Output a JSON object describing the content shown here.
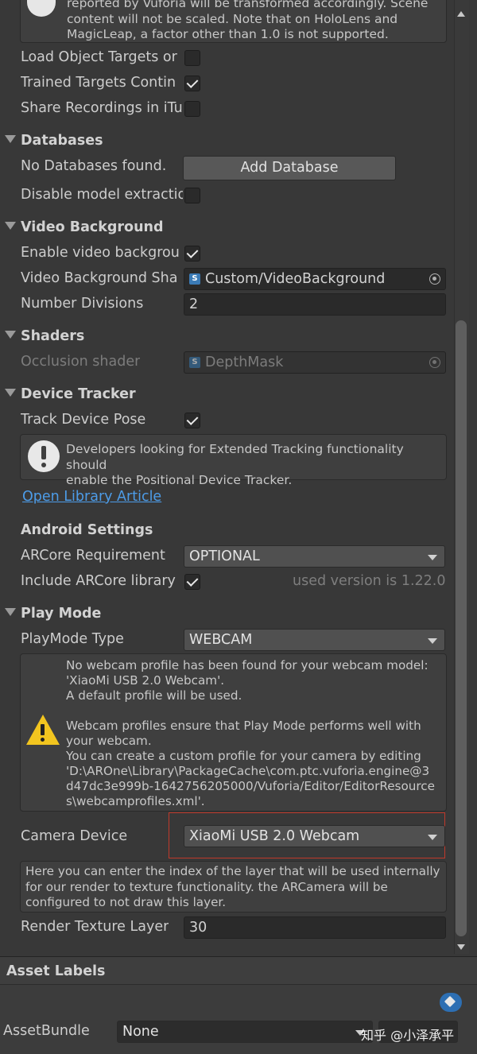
{
  "top_help": {
    "lines": [
      "reported by Vuforia will be transformed accordingly. Scene",
      "content will not be scaled. Note that on HoloLens and",
      "MagicLeap, a factor other than 1.0 is not supported."
    ]
  },
  "top_rows": [
    {
      "label": "Load Object Targets or",
      "checked": false
    },
    {
      "label": "Trained Targets Contin",
      "checked": true
    },
    {
      "label": "Share Recordings in iTu",
      "checked": false
    }
  ],
  "databases": {
    "header": "Databases",
    "none_label": "No Databases found.",
    "add_button": "Add Database",
    "disable_label": "Disable model extractio"
  },
  "video_background": {
    "header": "Video Background",
    "enable_label": "Enable video backgrou",
    "shader_label": "Video Background Sha",
    "shader_value": "Custom/VideoBackground",
    "divisions_label": "Number Divisions",
    "divisions_value": "2"
  },
  "shaders": {
    "header": "Shaders",
    "occlusion_label": "Occlusion shader",
    "occlusion_value": "DepthMask"
  },
  "device_tracker": {
    "header": "Device Tracker",
    "track_label": "Track Device Pose",
    "help_lines": [
      "Developers looking for Extended Tracking functionality should",
      "enable the Positional Device Tracker."
    ],
    "link": "Open Library Article"
  },
  "android": {
    "header": "Android Settings",
    "arcore_req_label": "ARCore Requirement",
    "arcore_req_value": "OPTIONAL",
    "include_label": "Include ARCore library",
    "version_text": "used version is 1.22.0"
  },
  "play_mode": {
    "header": "Play Mode",
    "type_label": "PlayMode Type",
    "type_value": "WEBCAM",
    "warning_lines": [
      "No webcam profile has been found for your webcam model:",
      "'XiaoMi USB 2.0 Webcam'.",
      "A default profile will be used.",
      "",
      "Webcam profiles ensure that Play Mode performs well with",
      "your webcam.",
      "You can create a custom profile for your camera by editing",
      "'D:\\AROne\\Library\\PackageCache\\com.ptc.vuforia.engine@3",
      "d47dc3e999b-1642756205000/Vuforia/Editor/EditorResource",
      "s\\webcamprofiles.xml'."
    ],
    "camera_label": "Camera Device",
    "camera_value": "XiaoMi USB 2.0 Webcam",
    "layer_help_lines": [
      "Here you can enter the index of the layer that will be used internally",
      "for our render to texture functionality. the ARCamera will be",
      "configured to not draw this layer."
    ],
    "render_layer_label": "Render Texture Layer",
    "render_layer_value": "30"
  },
  "asset_labels": {
    "header": "Asset Labels",
    "bundle_label": "AssetBundle",
    "bundle_value": "None",
    "watermark": "知乎 @小泽承平"
  }
}
